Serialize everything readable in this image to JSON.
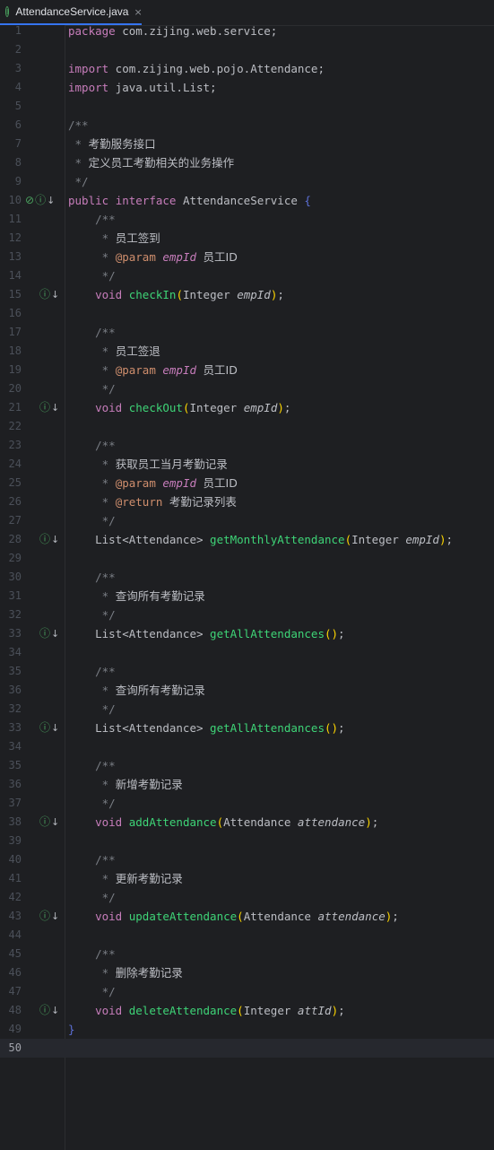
{
  "tab": {
    "filename": "AttendanceService.java",
    "close": "×",
    "icon": "interface-icon"
  },
  "editor": {
    "current_line": "50",
    "lines": [
      {
        "n": "1",
        "tokens": [
          [
            "kwv",
            "package"
          ],
          [
            "pk",
            " com.zijing.web.service;"
          ]
        ]
      },
      {
        "n": "2",
        "tokens": []
      },
      {
        "n": "3",
        "tokens": [
          [
            "kwv",
            "import"
          ],
          [
            "pk",
            " com.zijing.web.pojo.Attendance;"
          ]
        ]
      },
      {
        "n": "4",
        "tokens": [
          [
            "kwv",
            "import"
          ],
          [
            "pk",
            " java.util.List;"
          ]
        ]
      },
      {
        "n": "5",
        "tokens": []
      },
      {
        "n": "6",
        "tokens": [
          [
            "cm",
            "/**"
          ]
        ]
      },
      {
        "n": "7",
        "tokens": [
          [
            "cm",
            " * "
          ],
          [
            "cmt",
            "考勤服务接口"
          ]
        ]
      },
      {
        "n": "8",
        "tokens": [
          [
            "cm",
            " * "
          ],
          [
            "cmt",
            "定义员工考勤相关的业务操作"
          ]
        ]
      },
      {
        "n": "9",
        "tokens": [
          [
            "cm",
            " */"
          ]
        ]
      },
      {
        "n": "10",
        "gutter": "both",
        "tokens": [
          [
            "kwv",
            "public"
          ],
          [
            "pk",
            " "
          ],
          [
            "kwv",
            "interface"
          ],
          [
            "pk",
            " AttendanceService "
          ],
          [
            "curly",
            "{"
          ]
        ]
      },
      {
        "n": "11",
        "tokens": [
          [
            "cm",
            "    /**"
          ]
        ]
      },
      {
        "n": "12",
        "tokens": [
          [
            "cm",
            "     * "
          ],
          [
            "cmt",
            "员工签到"
          ]
        ]
      },
      {
        "n": "13",
        "tokens": [
          [
            "cm",
            "     * "
          ],
          [
            "tag",
            "@param"
          ],
          [
            "cm",
            " "
          ],
          [
            "prm",
            "empId"
          ],
          [
            "cm",
            " "
          ],
          [
            "cmt",
            "员工ID"
          ]
        ]
      },
      {
        "n": "14",
        "tokens": [
          [
            "cm",
            "     */"
          ]
        ]
      },
      {
        "n": "15",
        "gutter": "impl",
        "tokens": [
          [
            "pk",
            "    "
          ],
          [
            "kwv",
            "void"
          ],
          [
            "pk",
            " "
          ],
          [
            "fnd",
            "checkIn"
          ],
          [
            "br",
            "("
          ],
          [
            "ty",
            "Integer "
          ],
          [
            "par",
            "empId"
          ],
          [
            "br",
            ")"
          ],
          [
            "pk",
            ";"
          ]
        ]
      },
      {
        "n": "16",
        "tokens": []
      },
      {
        "n": "17",
        "tokens": [
          [
            "cm",
            "    /**"
          ]
        ]
      },
      {
        "n": "18",
        "tokens": [
          [
            "cm",
            "     * "
          ],
          [
            "cmt",
            "员工签退"
          ]
        ]
      },
      {
        "n": "19",
        "tokens": [
          [
            "cm",
            "     * "
          ],
          [
            "tag",
            "@param"
          ],
          [
            "cm",
            " "
          ],
          [
            "prm",
            "empId"
          ],
          [
            "cm",
            " "
          ],
          [
            "cmt",
            "员工ID"
          ]
        ]
      },
      {
        "n": "20",
        "tokens": [
          [
            "cm",
            "     */"
          ]
        ]
      },
      {
        "n": "21",
        "gutter": "impl",
        "tokens": [
          [
            "pk",
            "    "
          ],
          [
            "kwv",
            "void"
          ],
          [
            "pk",
            " "
          ],
          [
            "fnd",
            "checkOut"
          ],
          [
            "br",
            "("
          ],
          [
            "ty",
            "Integer "
          ],
          [
            "par",
            "empId"
          ],
          [
            "br",
            ")"
          ],
          [
            "pk",
            ";"
          ]
        ]
      },
      {
        "n": "22",
        "tokens": []
      },
      {
        "n": "23",
        "tokens": [
          [
            "cm",
            "    /**"
          ]
        ]
      },
      {
        "n": "24",
        "tokens": [
          [
            "cm",
            "     * "
          ],
          [
            "cmt",
            "获取员工当月考勤记录"
          ]
        ]
      },
      {
        "n": "25",
        "tokens": [
          [
            "cm",
            "     * "
          ],
          [
            "tag",
            "@param"
          ],
          [
            "cm",
            " "
          ],
          [
            "prm",
            "empId"
          ],
          [
            "cm",
            " "
          ],
          [
            "cmt",
            "员工ID"
          ]
        ]
      },
      {
        "n": "26",
        "tokens": [
          [
            "cm",
            "     * "
          ],
          [
            "tag",
            "@return"
          ],
          [
            "cm",
            " "
          ],
          [
            "cmt",
            "考勤记录列表"
          ]
        ]
      },
      {
        "n": "27",
        "tokens": [
          [
            "cm",
            "     */"
          ]
        ]
      },
      {
        "n": "28",
        "gutter": "impl",
        "tokens": [
          [
            "pk",
            "    List<Attendance> "
          ],
          [
            "fnd",
            "getMonthlyAttendance"
          ],
          [
            "br",
            "("
          ],
          [
            "ty",
            "Integer "
          ],
          [
            "par",
            "empId"
          ],
          [
            "br",
            ")"
          ],
          [
            "pk",
            ";"
          ]
        ]
      },
      {
        "n": "29",
        "tokens": []
      },
      {
        "n": "30",
        "tokens": [
          [
            "cm",
            "    /**"
          ]
        ]
      },
      {
        "n": "31",
        "tokens": [
          [
            "cm",
            "     * "
          ],
          [
            "cmt",
            "查询所有考勤记录"
          ]
        ]
      },
      {
        "n": "32",
        "tokens": [
          [
            "cm",
            "     */"
          ]
        ]
      },
      {
        "n": "33",
        "gutter": "impl",
        "tokens": [
          [
            "pk",
            "    List<Attendance> "
          ],
          [
            "fnd",
            "getAllAttendances"
          ],
          [
            "br",
            "()"
          ],
          [
            "pk",
            ";"
          ]
        ]
      },
      {
        "n": "34",
        "tokens": []
      },
      {
        "n": "35",
        "tokens": [
          [
            "cm",
            "    /**"
          ]
        ]
      },
      {
        "n": "36",
        "tokens": [
          [
            "cm",
            "     * "
          ],
          [
            "cmt",
            "查询所有考勤记录"
          ]
        ]
      },
      {
        "n": "32",
        "tokens": [
          [
            "cm",
            "     */"
          ]
        ]
      },
      {
        "n": "33",
        "gutter": "impl",
        "tokens": [
          [
            "pk",
            "    List<Attendance> "
          ],
          [
            "fnd",
            "getAllAttendances"
          ],
          [
            "br",
            "()"
          ],
          [
            "pk",
            ";"
          ]
        ]
      },
      {
        "n": "34",
        "tokens": []
      },
      {
        "n": "35",
        "tokens": [
          [
            "cm",
            "    /**"
          ]
        ]
      },
      {
        "n": "36",
        "tokens": [
          [
            "cm",
            "     * "
          ],
          [
            "cmt",
            "新增考勤记录"
          ]
        ]
      },
      {
        "n": "37",
        "tokens": [
          [
            "cm",
            "     */"
          ]
        ]
      },
      {
        "n": "38",
        "gutter": "impl",
        "tokens": [
          [
            "pk",
            "    "
          ],
          [
            "kwv",
            "void"
          ],
          [
            "pk",
            " "
          ],
          [
            "fnd",
            "addAttendance"
          ],
          [
            "br",
            "("
          ],
          [
            "ty",
            "Attendance "
          ],
          [
            "par",
            "attendance"
          ],
          [
            "br",
            ")"
          ],
          [
            "pk",
            ";"
          ]
        ]
      },
      {
        "n": "39",
        "tokens": []
      },
      {
        "n": "40",
        "tokens": [
          [
            "cm",
            "    /**"
          ]
        ]
      },
      {
        "n": "41",
        "tokens": [
          [
            "cm",
            "     * "
          ],
          [
            "cmt",
            "更新考勤记录"
          ]
        ]
      },
      {
        "n": "42",
        "tokens": [
          [
            "cm",
            "     */"
          ]
        ]
      },
      {
        "n": "43",
        "gutter": "impl",
        "tokens": [
          [
            "pk",
            "    "
          ],
          [
            "kwv",
            "void"
          ],
          [
            "pk",
            " "
          ],
          [
            "fnd",
            "updateAttendance"
          ],
          [
            "br",
            "("
          ],
          [
            "ty",
            "Attendance "
          ],
          [
            "par",
            "attendance"
          ],
          [
            "br",
            ")"
          ],
          [
            "pk",
            ";"
          ]
        ]
      },
      {
        "n": "44",
        "tokens": []
      },
      {
        "n": "45",
        "tokens": [
          [
            "cm",
            "    /**"
          ]
        ]
      },
      {
        "n": "46",
        "tokens": [
          [
            "cm",
            "     * "
          ],
          [
            "cmt",
            "删除考勤记录"
          ]
        ]
      },
      {
        "n": "47",
        "tokens": [
          [
            "cm",
            "     */"
          ]
        ]
      },
      {
        "n": "48",
        "gutter": "impl",
        "tokens": [
          [
            "pk",
            "    "
          ],
          [
            "kwv",
            "void"
          ],
          [
            "pk",
            " "
          ],
          [
            "fnd",
            "deleteAttendance"
          ],
          [
            "br",
            "("
          ],
          [
            "ty",
            "Integer "
          ],
          [
            "par",
            "attId"
          ],
          [
            "br",
            ")"
          ],
          [
            "pk",
            ";"
          ]
        ]
      },
      {
        "n": "49",
        "tokens": [
          [
            "curly",
            "}"
          ]
        ]
      },
      {
        "n": "50",
        "tokens": []
      }
    ]
  }
}
